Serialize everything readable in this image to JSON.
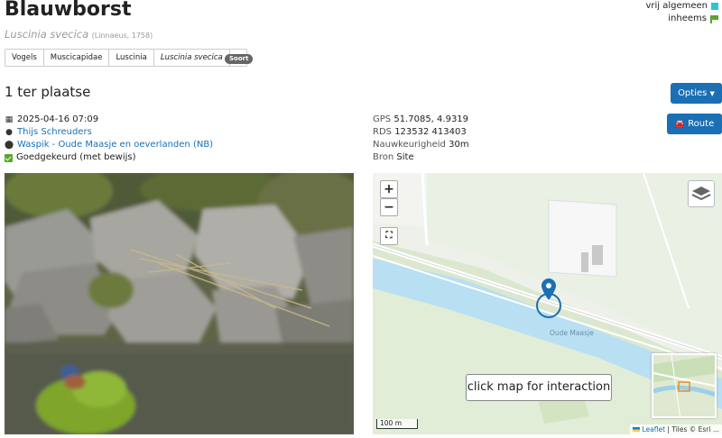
{
  "header": {
    "title": "Blauwborst",
    "scientific_name": "Luscinia svecica",
    "authority": "(Linnaeus, 1758)"
  },
  "status": {
    "abundance": "vrij algemeen",
    "origin": "inheems",
    "abundance_color": "#2ec4d6",
    "origin_color": "#5aa62a"
  },
  "taxonomy": {
    "items": [
      "Vogels",
      "Muscicapidae",
      "Luscinia",
      "Luscinia svecica"
    ],
    "dropdown_icon": "caret-down-icon",
    "rank_badge": "Soort"
  },
  "observation": {
    "count_label": "1 ter plaatse",
    "datetime": "2025-04-16 07:09",
    "observer": "Thijs Schreuders",
    "location": "Waspik - Oude Maasje en oeverlanden (NB)",
    "validation": "Goedgekeurd (met bewijs)"
  },
  "geo": {
    "gps_label": "GPS",
    "gps_value": "51.7085, 4.9319",
    "rds_label": "RDS",
    "rds_value": "123532 413403",
    "accuracy_label": "Nauwkeurigheid",
    "accuracy_value": "30m",
    "source_label": "Bron",
    "source_value": "Site"
  },
  "buttons": {
    "opties": "Opties",
    "route": "Route"
  },
  "map": {
    "zoom_in": "+",
    "zoom_out": "−",
    "click_hint": "click map for interaction",
    "river_label": "Oude Maasje",
    "scale_label": "100 m",
    "attribution_link": "Leaflet",
    "attribution_rest": " | Tiles © Esri ..."
  },
  "colors": {
    "accent": "#1a6fb5",
    "link": "#1a6fb5"
  }
}
